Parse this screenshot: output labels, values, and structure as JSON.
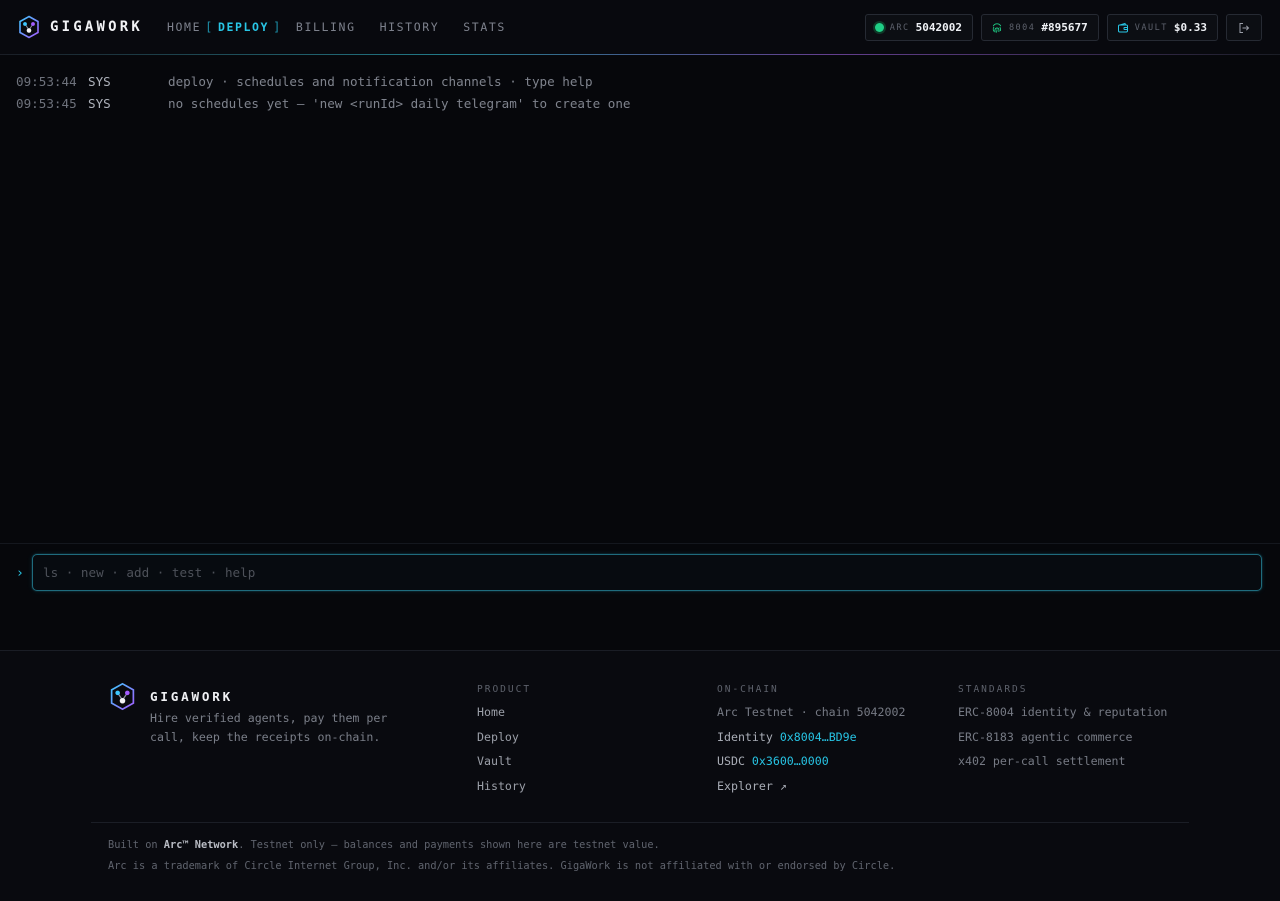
{
  "header": {
    "brand": "GIGAWORK",
    "nav": [
      {
        "label": "HOME"
      },
      {
        "label": "DEPLOY",
        "active": true
      },
      {
        "label": "BILLING"
      },
      {
        "label": "HISTORY"
      },
      {
        "label": "STATS"
      }
    ],
    "chips": {
      "arc": {
        "key": "ARC",
        "value": "5042002",
        "icon": "status-dot-icon"
      },
      "erc": {
        "key": "8004",
        "value": "#895677",
        "icon": "fingerprint-icon"
      },
      "vault": {
        "key": "VAULT",
        "value": "$0.33",
        "icon": "wallet-icon"
      }
    },
    "logout_icon": "logout-icon"
  },
  "console": {
    "lines": [
      {
        "time": "09:53:44",
        "source": "SYS",
        "message": "deploy · schedules and notification channels · type help"
      },
      {
        "time": "09:53:45",
        "source": "SYS",
        "message": "no schedules yet — 'new <runId> daily telegram' to create one"
      }
    ],
    "prompt": "›",
    "input_value": "",
    "placeholder": "ls · new · add · test · help"
  },
  "footer": {
    "brand": "GIGAWORK",
    "tagline": "Hire verified agents, pay them per call, keep the receipts on-chain.",
    "product": {
      "heading": "PRODUCT",
      "links": [
        "Home",
        "Deploy",
        "Vault",
        "History"
      ]
    },
    "onchain": {
      "heading": "ON-CHAIN",
      "network": "Arc Testnet · chain 5042002",
      "identity_label": "Identity",
      "identity_addr": "0x8004…BD9e",
      "usdc_label": "USDC",
      "usdc_addr": "0x3600…0000",
      "explorer": "Explorer ↗"
    },
    "standards": {
      "heading": "STANDARDS",
      "items": [
        "ERC-8004 identity & reputation",
        "ERC-8183 agentic commerce",
        "x402 per-call settlement"
      ]
    },
    "note_prefix": "Built on ",
    "note_bold": "Arc™ Network",
    "note_suffix": ". Testnet only — balances and payments shown here are testnet value.",
    "trademark": "Arc is a trademark of Circle Internet Group, Inc. and/or its affiliates. GigaWork is not affiliated with or endorsed by Circle."
  },
  "colors": {
    "accent": "#28c6e6",
    "accent_purple": "#a05ae6",
    "status_green": "#1fcf86",
    "background": "#06070b"
  }
}
